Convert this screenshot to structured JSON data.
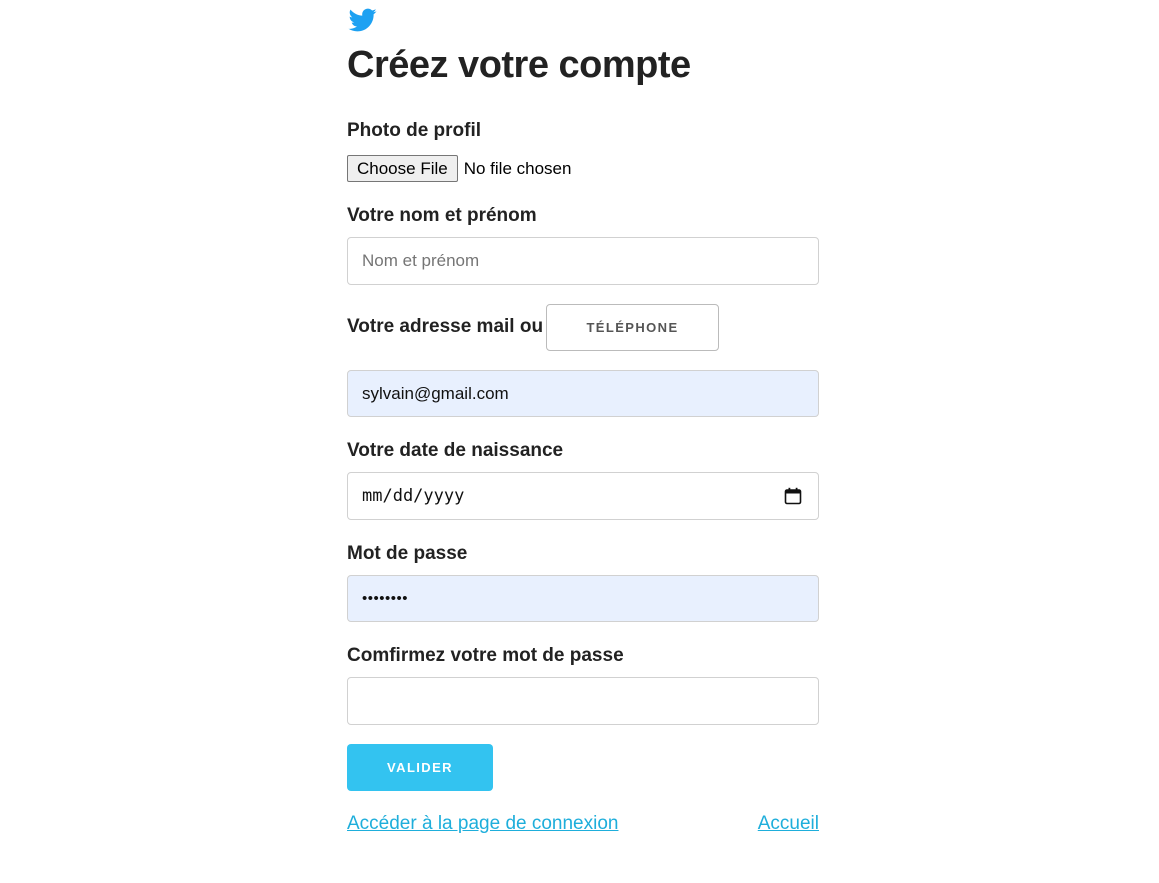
{
  "brand": {
    "logo_icon": "twitter-bird-icon",
    "logo_color": "#1da1f2"
  },
  "form": {
    "title": "Créez votre compte",
    "photo": {
      "label": "Photo de profil",
      "button_label": "Choose File",
      "status": "No file chosen"
    },
    "name": {
      "label": "Votre nom et prénom",
      "placeholder": "Nom et prénom",
      "value": ""
    },
    "contact": {
      "label": "Votre adresse mail ou",
      "toggle_label": "TÉLÉPHONE",
      "value": "sylvain@gmail.com"
    },
    "birthdate": {
      "label": "Votre date de naissance",
      "placeholder": "mm/dd/yyyy",
      "icon": "calendar-icon"
    },
    "password": {
      "label": "Mot de passe",
      "masked_value": "••••••••"
    },
    "confirm_password": {
      "label": "Comfirmez votre mot de passe",
      "value": ""
    },
    "submit_label": "VALIDER"
  },
  "links": {
    "login": "Accéder à la page de connexion",
    "home": "Accueil"
  },
  "colors": {
    "accent": "#33c3f0",
    "link": "#1eaedb",
    "autofill_bg": "#e8f0fe"
  }
}
